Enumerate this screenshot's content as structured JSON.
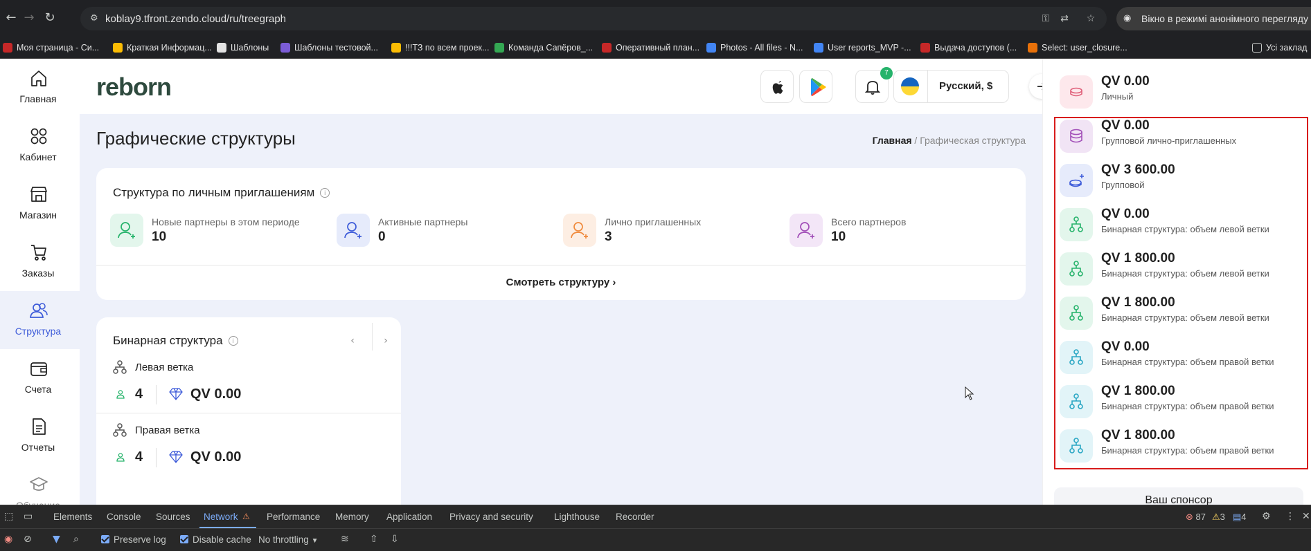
{
  "browser": {
    "url": "koblay9.tfront.zendo.cloud/ru/treegraph",
    "incognito_label": "Вікно в режимі анонімного перегляду",
    "bookmarks": [
      {
        "label": "Моя страница - Си...",
        "color": "#c62828"
      },
      {
        "label": "Краткая Информац...",
        "color": "#fbbc04"
      },
      {
        "label": "Шаблоны",
        "color": "#e3e3e3"
      },
      {
        "label": "Шаблоны тестовой...",
        "color": "#7b5cd6"
      },
      {
        "label": "!!!ТЗ по всем проек...",
        "color": "#fbbc04"
      },
      {
        "label": "Команда Сапёров_...",
        "color": "#34a853"
      },
      {
        "label": "Оперативный план...",
        "color": "#c62828"
      },
      {
        "label": "Photos - All files - N...",
        "color": "#4285f4"
      },
      {
        "label": "User reports_MVP -...",
        "color": "#4285f4"
      },
      {
        "label": "Выдача доступов (...",
        "color": "#c62828"
      },
      {
        "label": "Select: user_closure...",
        "color": "#e8710a"
      }
    ],
    "all_bookmarks_label": "Усі заклад"
  },
  "sidebar": {
    "items": [
      {
        "label": "Главная",
        "icon": "home-icon"
      },
      {
        "label": "Кабинет",
        "icon": "grid-icon"
      },
      {
        "label": "Магазин",
        "icon": "store-icon"
      },
      {
        "label": "Заказы",
        "icon": "cart-icon"
      },
      {
        "label": "Структура",
        "icon": "users-icon",
        "active": true
      },
      {
        "label": "Счета",
        "icon": "wallet-icon"
      },
      {
        "label": "Отчеты",
        "icon": "document-icon"
      },
      {
        "label": "Обучение",
        "icon": "graduation-icon"
      }
    ]
  },
  "header": {
    "logo": "reborn",
    "notifications_count": "7",
    "language": "Русский, $"
  },
  "main": {
    "title": "Графические структуры",
    "breadcrumb": {
      "home": "Главная",
      "separator": " / ",
      "current": "Графическая структура"
    },
    "invites_card": {
      "title": "Структура по личным приглашениям",
      "stats": [
        {
          "label": "Новые партнеры в этом периоде",
          "value": "10",
          "icon": "user-plus-icon",
          "bg": "#e3f6ec",
          "fg": "#26b36b"
        },
        {
          "label": "Активные партнеры",
          "value": "0",
          "icon": "user-check-icon",
          "bg": "#e6ebfb",
          "fg": "#3d5bd9"
        },
        {
          "label": "Лично приглашенных",
          "value": "3",
          "icon": "user-arrow-icon",
          "bg": "#fdeee3",
          "fg": "#f08a3c"
        },
        {
          "label": "Всего партнеров",
          "value": "10",
          "icon": "users-icon",
          "bg": "#f3e6f7",
          "fg": "#a24fb8"
        }
      ],
      "view_link": "Смотреть структуру ›"
    },
    "binary_card": {
      "title": "Бинарная структура",
      "branches": [
        {
          "title": "Левая ветка",
          "count": "4",
          "qv": "QV 0.00"
        },
        {
          "title": "Правая ветка",
          "count": "4",
          "qv": "QV 0.00"
        }
      ]
    }
  },
  "right_panel": {
    "rows": [
      {
        "value": "QV 0.00",
        "label": "Личный",
        "icon": "coin-icon",
        "bg": "#fde8ec",
        "fg": "#e0607a"
      },
      {
        "value": "QV 0.00",
        "label": "Групповой лично-приглашенных",
        "icon": "coins-stack-icon",
        "bg": "#f1e4f5",
        "fg": "#a24fb8"
      },
      {
        "value": "QV 3 600.00",
        "label": "Групповой",
        "icon": "coin-plus-icon",
        "bg": "#e6ebfb",
        "fg": "#3d5bd9"
      },
      {
        "value": "QV 0.00",
        "label": "Бинарная структура: объем левой ветки",
        "icon": "tree-icon",
        "bg": "#e3f6ec",
        "fg": "#26b36b"
      },
      {
        "value": "QV 1 800.00",
        "label": "Бинарная структура: объем левой ветки",
        "icon": "tree-icon",
        "bg": "#e3f6ec",
        "fg": "#26b36b"
      },
      {
        "value": "QV 1 800.00",
        "label": "Бинарная структура: объем левой ветки",
        "icon": "tree-icon",
        "bg": "#e3f6ec",
        "fg": "#26b36b"
      },
      {
        "value": "QV 0.00",
        "label": "Бинарная структура: объем правой ветки",
        "icon": "tree-icon",
        "bg": "#e2f4f8",
        "fg": "#2aa7c4"
      },
      {
        "value": "QV 1 800.00",
        "label": "Бинарная структура: объем правой ветки",
        "icon": "tree-icon",
        "bg": "#e2f4f8",
        "fg": "#2aa7c4"
      },
      {
        "value": "QV 1 800.00",
        "label": "Бинарная структура: объем правой ветки",
        "icon": "tree-icon",
        "bg": "#e2f4f8",
        "fg": "#2aa7c4"
      }
    ],
    "sponsor_label": "Ваш спонсор"
  },
  "devtools": {
    "tabs": [
      "Elements",
      "Console",
      "Sources",
      "Network",
      "Performance",
      "Memory",
      "Application",
      "Privacy and security",
      "Lighthouse",
      "Recorder"
    ],
    "active_tab": "Network",
    "errors": "87",
    "warnings": "3",
    "infos": "4",
    "preserve_log": "Preserve log",
    "disable_cache": "Disable cache",
    "throttling": "No throttling"
  }
}
